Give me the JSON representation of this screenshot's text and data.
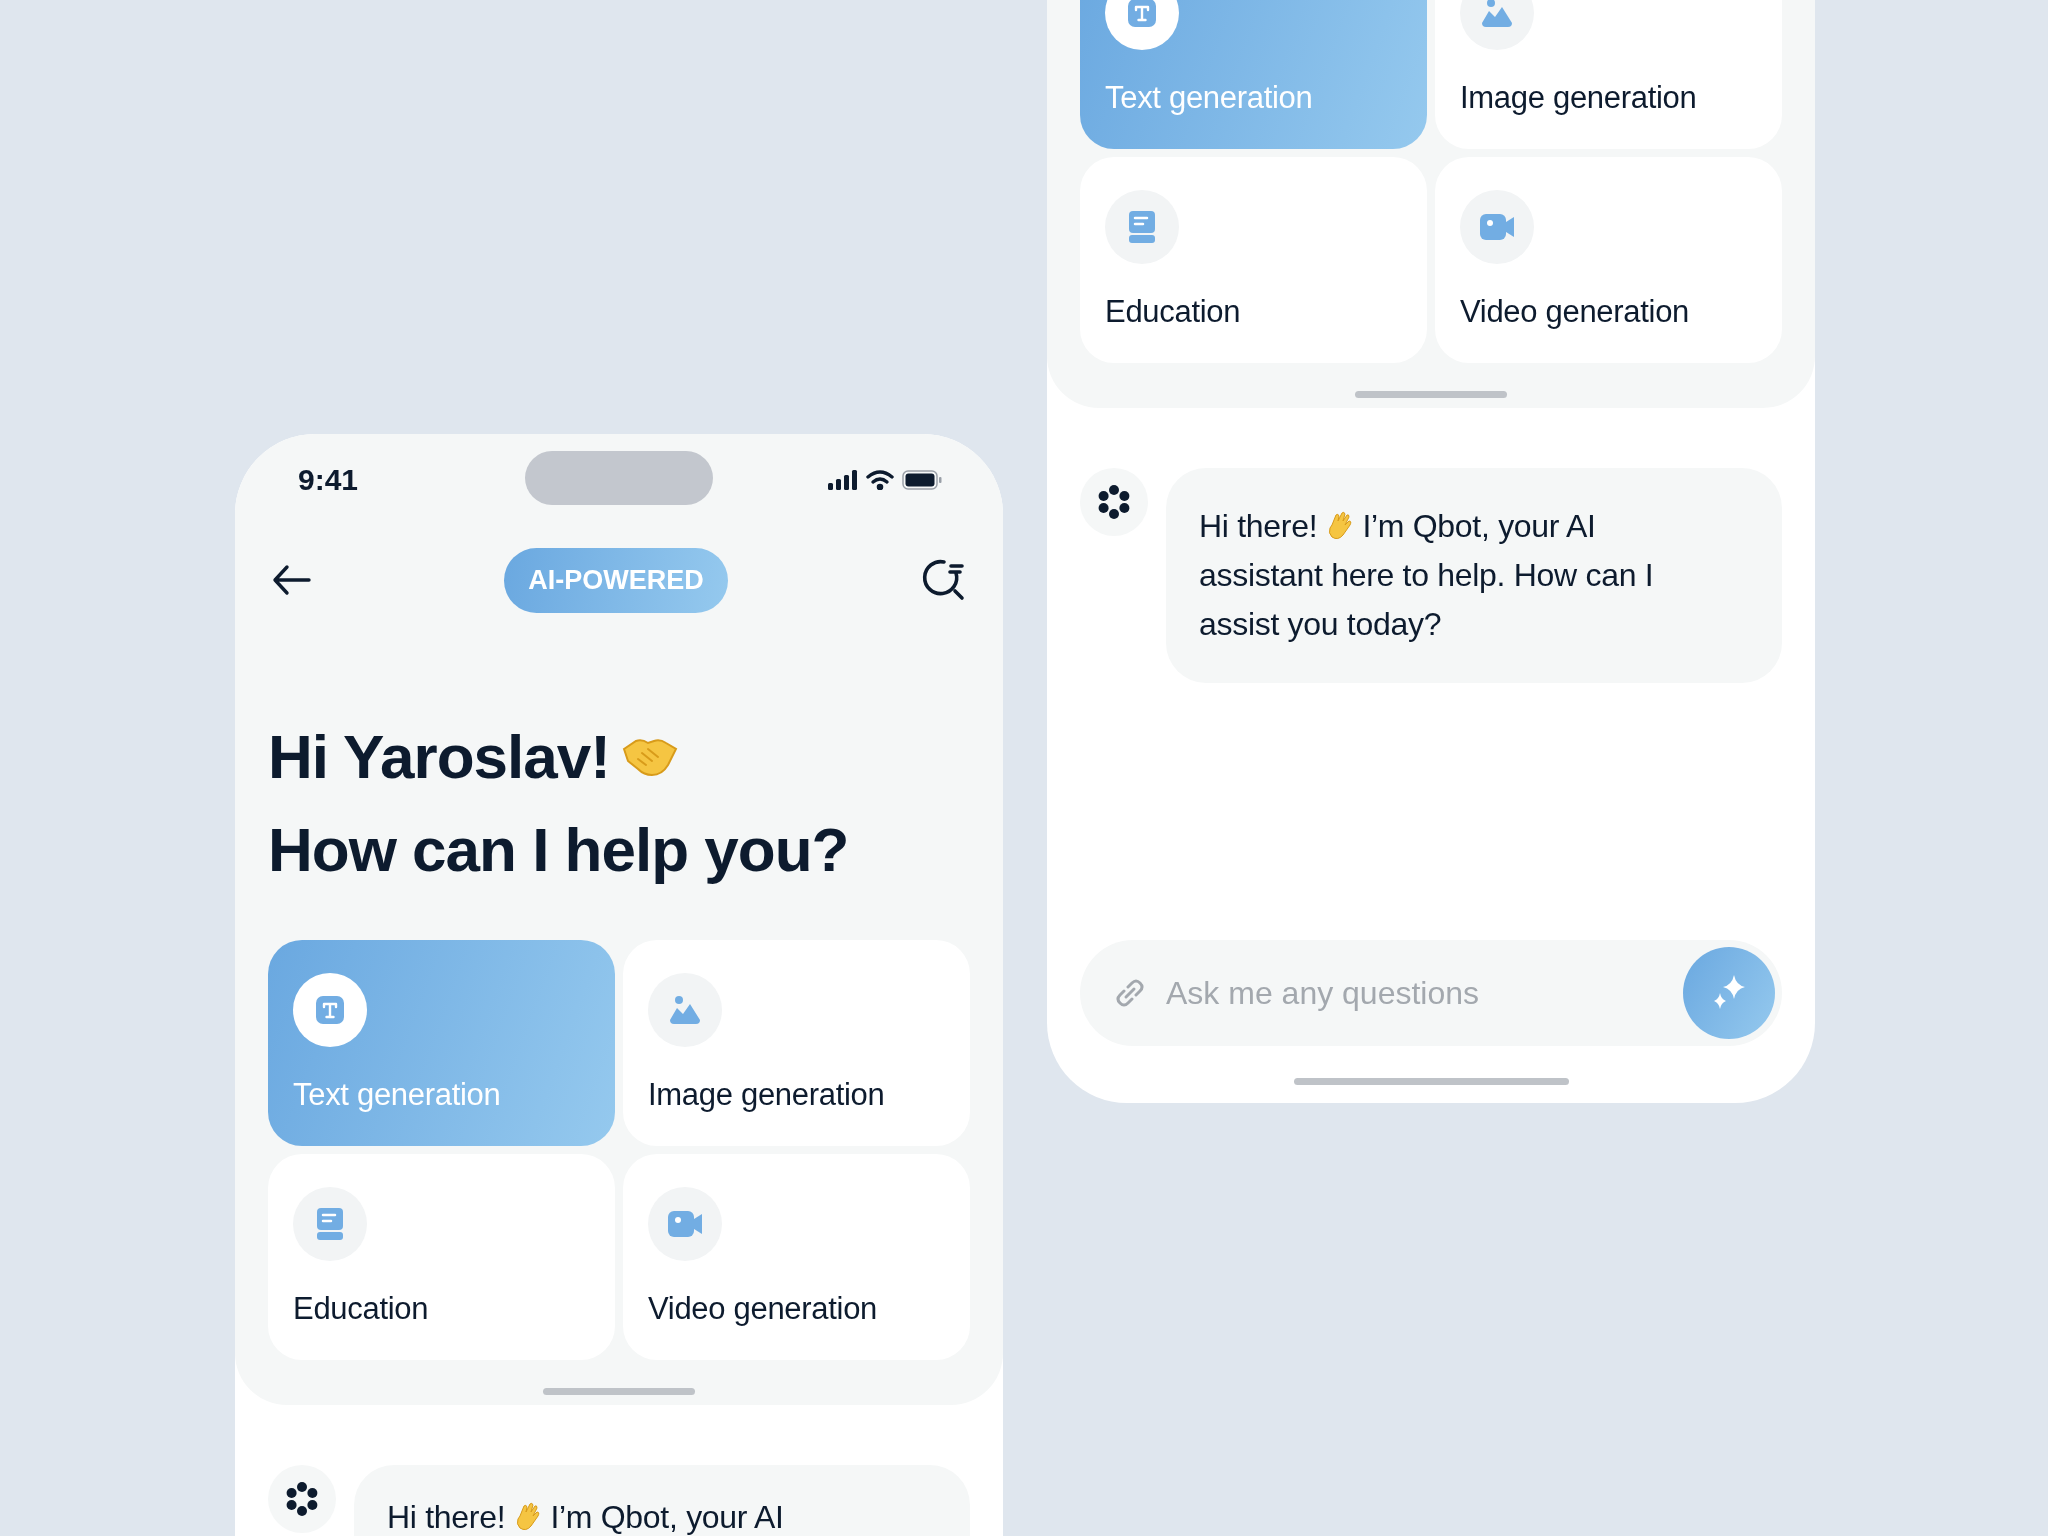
{
  "left_screen": {
    "status_bar": {
      "time": "9:41"
    },
    "badge": "AI-POWERED",
    "greeting": [
      "Hi Yaroslav!",
      "How can I help you?"
    ],
    "categories": [
      {
        "label": "Text generation",
        "kind": "text",
        "selected": true
      },
      {
        "label": "Image generation",
        "kind": "image",
        "selected": false
      },
      {
        "label": "Education",
        "kind": "education",
        "selected": false
      },
      {
        "label": "Video generation",
        "kind": "video",
        "selected": false
      }
    ],
    "chat": [
      {
        "greeting": "Hi there!",
        "message": "I’m Qbot, your AI"
      }
    ]
  },
  "right_screen": {
    "categories": [
      {
        "label": "Text generation",
        "kind": "text",
        "selected": true
      },
      {
        "label": "Image generation",
        "kind": "image",
        "selected": false
      },
      {
        "label": "Education",
        "kind": "education",
        "selected": false
      },
      {
        "label": "Video generation",
        "kind": "video",
        "selected": false
      }
    ],
    "chat": [
      {
        "greeting": "Hi there!",
        "message": "I’m Qbot, your AI assistant here to help. How can I assist you today?"
      }
    ],
    "input": {
      "placeholder": "Ask me any questions"
    }
  }
}
